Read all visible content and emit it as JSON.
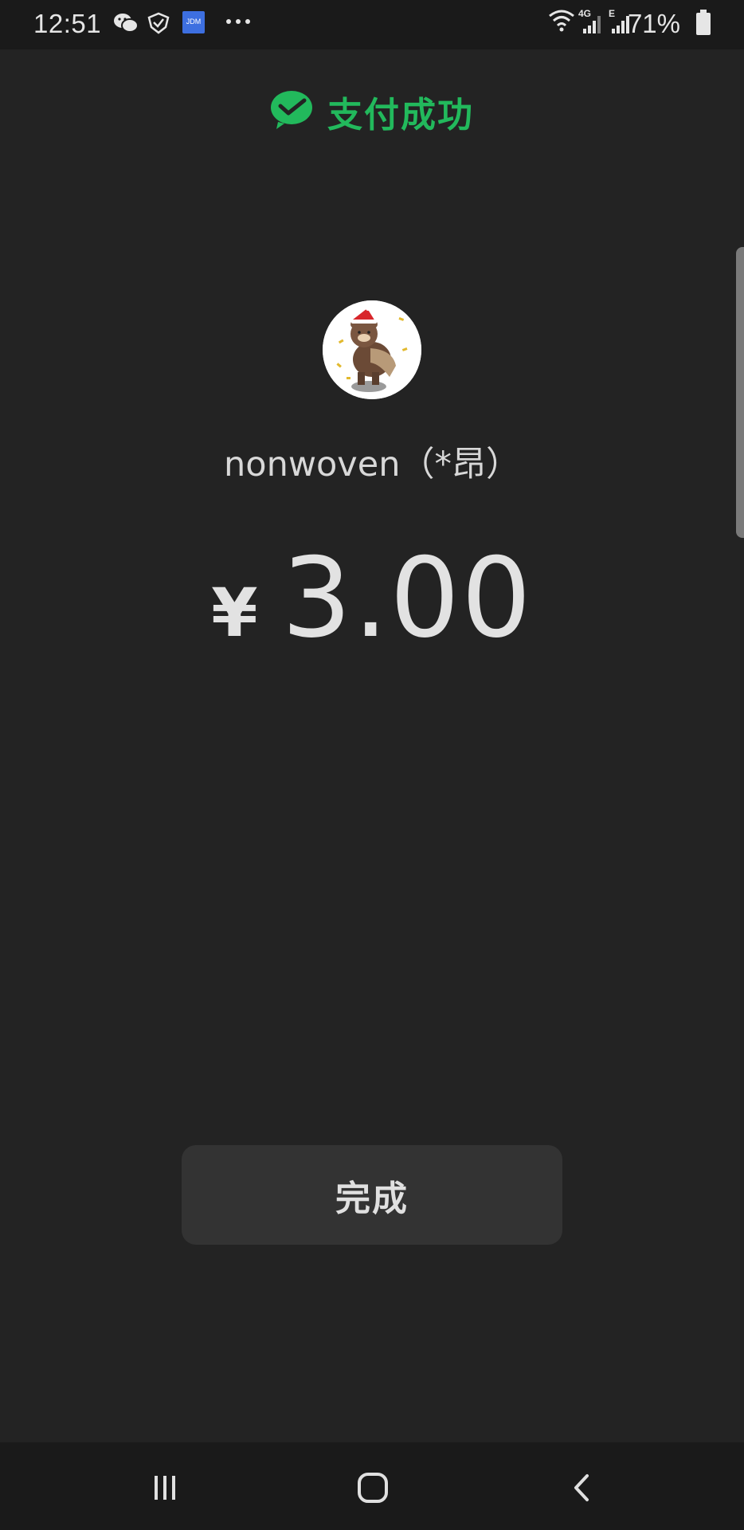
{
  "status_bar": {
    "time": "12:51",
    "notification_icons": [
      "wechat-icon",
      "shield-icon",
      "jdm-app-icon",
      "more-dots-icon"
    ],
    "jdm_label": "JDM",
    "network": [
      "wifi-icon",
      "signal-4g-icon",
      "signal-e-icon"
    ],
    "net_4g": "4G",
    "net_e": "E",
    "battery": "71%"
  },
  "header": {
    "title": "支付成功",
    "icon": "wechat-pay-check-icon",
    "accent_color": "#22b95c"
  },
  "payee": {
    "name": "nonwoven（*昂）",
    "avatar": "bear-avatar"
  },
  "payment": {
    "currency": "¥",
    "amount": "3.00"
  },
  "actions": {
    "done_label": "完成"
  },
  "nav_bar": {
    "buttons": [
      "recent-apps-icon",
      "home-icon",
      "back-icon"
    ]
  }
}
